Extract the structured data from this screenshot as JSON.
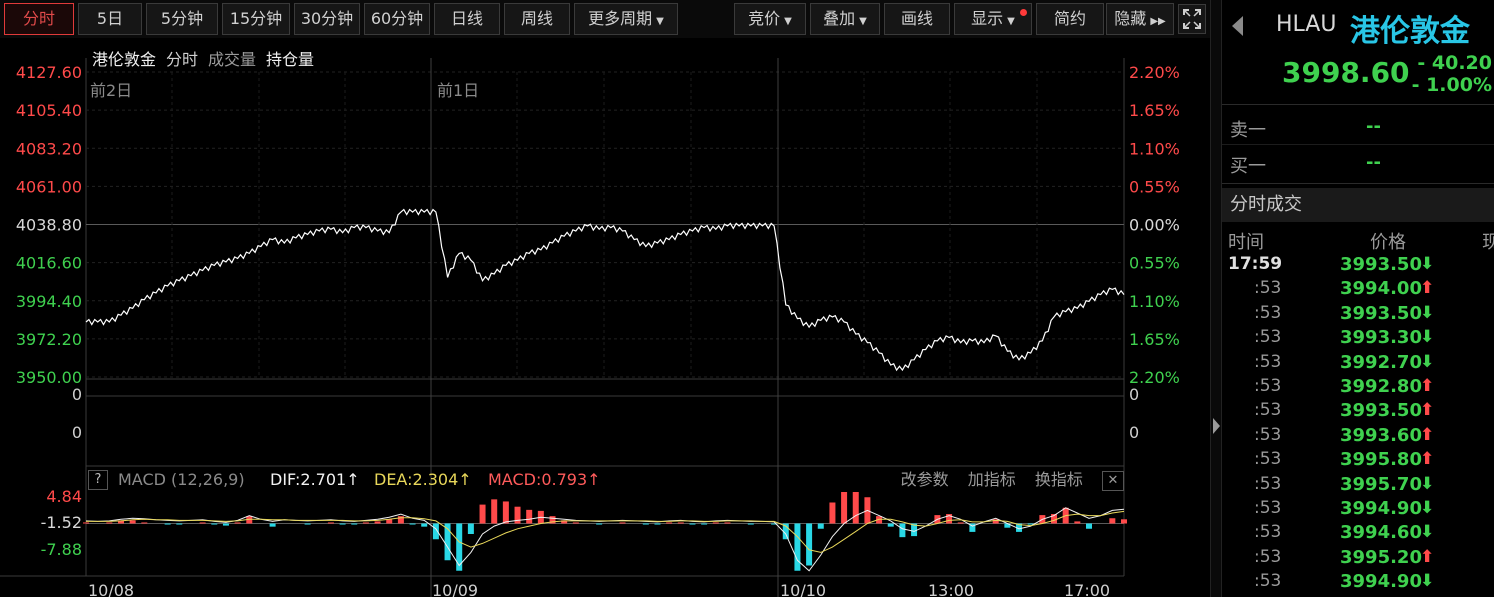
{
  "toolbar": {
    "periods": [
      "分时",
      "5日",
      "5分钟",
      "15分钟",
      "30分钟",
      "60分钟",
      "日线",
      "周线",
      "更多周期"
    ],
    "active_period": "分时",
    "tools": [
      "竞价",
      "叠加",
      "画线",
      "显示",
      "简约",
      "隐藏"
    ]
  },
  "chart": {
    "legend": {
      "name": "港伦敦金",
      "mode": "分时",
      "volume": "成交量",
      "open_interest": "持仓量"
    },
    "day_labels": [
      "前2日",
      "前1日"
    ],
    "price_ticks": [
      "4127.60",
      "4105.40",
      "4083.20",
      "4061.00",
      "4038.80",
      "4016.60",
      "3994.40",
      "3972.20",
      "3950.00"
    ],
    "pct_ticks": [
      "2.20%",
      "1.65%",
      "1.10%",
      "0.55%",
      "0.00%",
      "0.55%",
      "1.10%",
      "1.65%",
      "2.20%"
    ],
    "volume_ticks": [
      "0",
      "0"
    ],
    "volume_ticks_right": [
      "0",
      "0"
    ],
    "macd_ticks": [
      "4.84",
      "-1.52",
      "-7.88"
    ],
    "x_ticks": [
      "10/08",
      "10/09",
      "10/10",
      "13:00",
      "17:00"
    ],
    "colors": {
      "up": "#ff4a4a",
      "down": "#3fd14f",
      "line": "#ffffff",
      "dea": "#e8d75a",
      "cyan": "#29d8e6"
    }
  },
  "macd": {
    "help": "?",
    "name": "MACD (12,26,9)",
    "dif": "DIF:2.701↑",
    "dea": "DEA:2.304↑",
    "value": "MACD:0.793↑",
    "actions": [
      "改参数",
      "加指标",
      "换指标"
    ],
    "close": "✕"
  },
  "chart_data": {
    "type": "line",
    "title": "港伦敦金",
    "ylim": [
      3950.0,
      4127.6
    ],
    "ref_price": 4038.8,
    "x": [
      "10/08",
      "10/09",
      "10/10",
      "13:00",
      "17:00"
    ],
    "series": [
      {
        "name": "港伦敦金",
        "values": [
          3982,
          3982,
          3982,
          3986,
          3990,
          3995,
          3999,
          4003,
          4006,
          4009,
          4012,
          4015,
          4017,
          4019,
          4022,
          4026,
          4030,
          4028,
          4031,
          4033,
          4035,
          4036,
          4034,
          4037,
          4037,
          4035,
          4034,
          4046,
          4046,
          4046,
          4046,
          4008,
          4022,
          4018,
          4006,
          4010,
          4015,
          4018,
          4022,
          4024,
          4028,
          4032,
          4035,
          4038,
          4036,
          4037,
          4035,
          4030,
          4026,
          4028,
          4030,
          4033,
          4035,
          4037,
          4036,
          4038,
          4038,
          4038,
          4038,
          4038,
          3992,
          3984,
          3979,
          3983,
          3985,
          3982,
          3975,
          3970,
          3964,
          3957,
          3954,
          3960,
          3966,
          3971,
          3973,
          3970,
          3971,
          3970,
          3974,
          3965,
          3960,
          3964,
          3971,
          3985,
          3988,
          3990,
          3994,
          3998,
          4001,
          3998
        ]
      }
    ],
    "macd": {
      "dif_series": [
        0.5,
        0.4,
        0.5,
        0.8,
        1.0,
        0.9,
        0.7,
        0.6,
        0.5,
        0.6,
        0.7,
        0.4,
        0.2,
        0.6,
        1.5,
        0.8,
        0.4,
        0.7,
        0.6,
        0.5,
        0.6,
        0.7,
        0.5,
        0.4,
        0.6,
        0.8,
        1.2,
        1.8,
        1.0,
        0.6,
        -1.0,
        -4.5,
        -8.0,
        -5.5,
        -2.0,
        -0.5,
        0.3,
        0.6,
        0.8,
        1.2,
        1.0,
        0.8,
        0.6,
        0.5,
        0.4,
        0.5,
        0.6,
        0.5,
        0.4,
        0.3,
        0.5,
        0.6,
        0.4,
        0.3,
        0.5,
        0.6,
        0.5,
        0.4,
        0.4,
        0.3,
        -2.0,
        -7.0,
        -9.0,
        -6.0,
        -2.5,
        0.0,
        1.5,
        2.5,
        1.5,
        0.5,
        -1.0,
        -1.5,
        -0.5,
        0.8,
        1.5,
        0.8,
        -0.5,
        0.3,
        1.0,
        0.0,
        -1.0,
        -0.5,
        0.8,
        1.5,
        3.0,
        2.0,
        1.0,
        1.5,
        2.5,
        2.7
      ],
      "dea_series": [
        0.4,
        0.4,
        0.4,
        0.5,
        0.7,
        0.8,
        0.7,
        0.7,
        0.6,
        0.6,
        0.6,
        0.5,
        0.4,
        0.5,
        0.8,
        0.8,
        0.7,
        0.7,
        0.6,
        0.6,
        0.6,
        0.6,
        0.6,
        0.5,
        0.5,
        0.6,
        0.8,
        1.1,
        1.1,
        0.9,
        0.5,
        -1.0,
        -3.5,
        -4.5,
        -3.8,
        -2.8,
        -1.8,
        -1.0,
        -0.5,
        0.0,
        0.3,
        0.5,
        0.5,
        0.5,
        0.5,
        0.5,
        0.5,
        0.5,
        0.5,
        0.4,
        0.4,
        0.5,
        0.5,
        0.4,
        0.4,
        0.5,
        0.5,
        0.5,
        0.4,
        0.4,
        -0.5,
        -2.5,
        -5.0,
        -5.5,
        -4.5,
        -3.0,
        -1.5,
        0.0,
        0.8,
        0.8,
        0.3,
        -0.3,
        -0.5,
        0.0,
        0.6,
        0.7,
        0.3,
        0.3,
        0.6,
        0.4,
        -0.2,
        -0.4,
        0.0,
        0.6,
        1.5,
        1.8,
        1.5,
        1.5,
        2.0,
        2.3
      ],
      "ylim": [
        -10.0,
        6.0
      ]
    }
  },
  "panel": {
    "code": "HLAU",
    "name": "港伦敦金",
    "price": "3998.60",
    "change": "- 40.20",
    "change_pct": "- 1.00%",
    "sell_label": "卖一",
    "sell_value": "--",
    "buy_label": "买一",
    "buy_value": "--",
    "trades_title": "分时成交",
    "col_time": "时间",
    "col_price": "价格",
    "col_vol": "现",
    "trades": [
      {
        "time": "17:59",
        "price": "3993.50",
        "dir": "⬇"
      },
      {
        "time": ":53",
        "price": "3994.00",
        "dir": "⬆"
      },
      {
        "time": ":53",
        "price": "3993.50",
        "dir": "⬇"
      },
      {
        "time": ":53",
        "price": "3993.30",
        "dir": "⬇"
      },
      {
        "time": ":53",
        "price": "3992.70",
        "dir": "⬇"
      },
      {
        "time": ":53",
        "price": "3992.80",
        "dir": "⬆"
      },
      {
        "time": ":53",
        "price": "3993.50",
        "dir": "⬆"
      },
      {
        "time": ":53",
        "price": "3993.60",
        "dir": "⬆"
      },
      {
        "time": ":53",
        "price": "3995.80",
        "dir": "⬆"
      },
      {
        "time": ":53",
        "price": "3995.70",
        "dir": "⬇"
      },
      {
        "time": ":53",
        "price": "3994.90",
        "dir": "⬇"
      },
      {
        "time": ":53",
        "price": "3994.60",
        "dir": "⬇"
      },
      {
        "time": ":53",
        "price": "3995.20",
        "dir": "⬆"
      },
      {
        "time": ":53",
        "price": "3994.90",
        "dir": "⬇"
      }
    ]
  }
}
